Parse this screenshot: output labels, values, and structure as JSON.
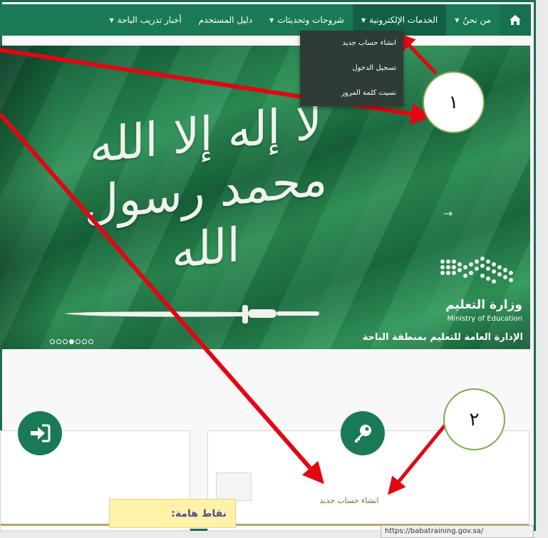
{
  "navbar": {
    "home_icon": "home-icon",
    "items": [
      {
        "label": "من نحنُ",
        "has_caret": true
      },
      {
        "label": "الخدمات الإلكترونية",
        "has_caret": true,
        "active": true
      },
      {
        "label": "شروحات وتحديثات",
        "has_caret": true
      },
      {
        "label": "دليل المستخدم",
        "has_caret": false
      },
      {
        "label": "أخبار تدريب الباحة",
        "has_caret": true
      }
    ]
  },
  "dropdown": {
    "items": [
      "انشاء حساب جديد",
      "تسجيل الدخول",
      "نسيت كلمة المرور"
    ]
  },
  "hero": {
    "shahada": "لا إله إلا الله محمد رسول الله",
    "ministry_name": "وزارة التعليم",
    "ministry_en": "Ministry of Education",
    "region": "الإدارة العامة للتعليم بمنطقة الباحة",
    "dots_count": 7,
    "active_dot": 3
  },
  "cards": {
    "left_icon": "sign-in-icon",
    "right_icon": "key-icon",
    "right_label": "انشاء حساب جديد"
  },
  "status_url": "https://babatraining.gov.sa/",
  "note": "نقاط هامة:",
  "callouts": [
    "١",
    "٢"
  ],
  "colors": {
    "nav_green": "#1b7a56",
    "dropdown_bg": "#2f3b35",
    "arrow_red": "#e30613",
    "callout_border": "#7cab4e",
    "note_bg": "#fdf2a8"
  }
}
